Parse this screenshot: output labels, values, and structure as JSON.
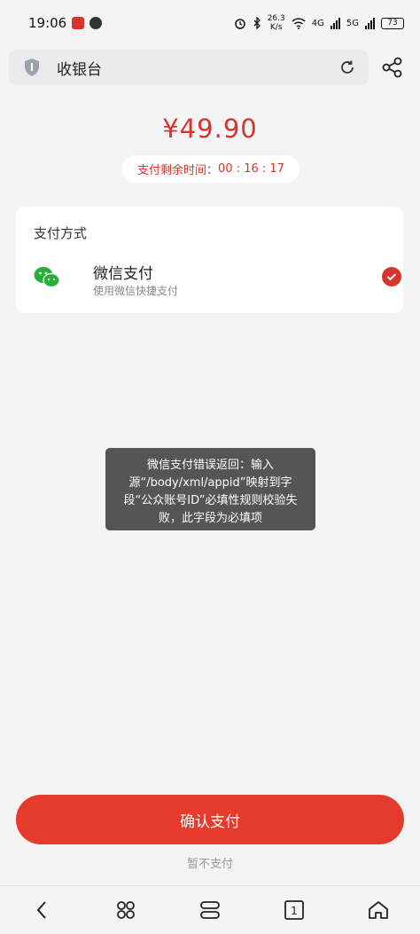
{
  "status_bar": {
    "time": "19:06",
    "net_speed_value": "26.3",
    "net_speed_unit": "K/s",
    "battery": "73",
    "signal_4g": "4G",
    "signal_5g": "5G"
  },
  "topbar": {
    "title": "收银台"
  },
  "payment": {
    "amount": "¥49.90",
    "timer_label": "支付剩余时间：",
    "timer_value": "00 : 16 : 17"
  },
  "method_card": {
    "title": "支付方式",
    "option_name": "微信支付",
    "option_desc": "使用微信快捷支付",
    "selected": true
  },
  "toast": {
    "message": "微信支付错误返回：输入源“/body/xml/appid”映射到字段“公众账号ID”必填性规则校验失败，此字段为必填项"
  },
  "actions": {
    "confirm_label": "确认支付",
    "skip_label": "暂不支付"
  },
  "nav": {
    "tabs_count": "1"
  },
  "colors": {
    "accent": "#e43b2c",
    "background": "#f4f4f4",
    "wechat_green": "#2aae3a"
  }
}
